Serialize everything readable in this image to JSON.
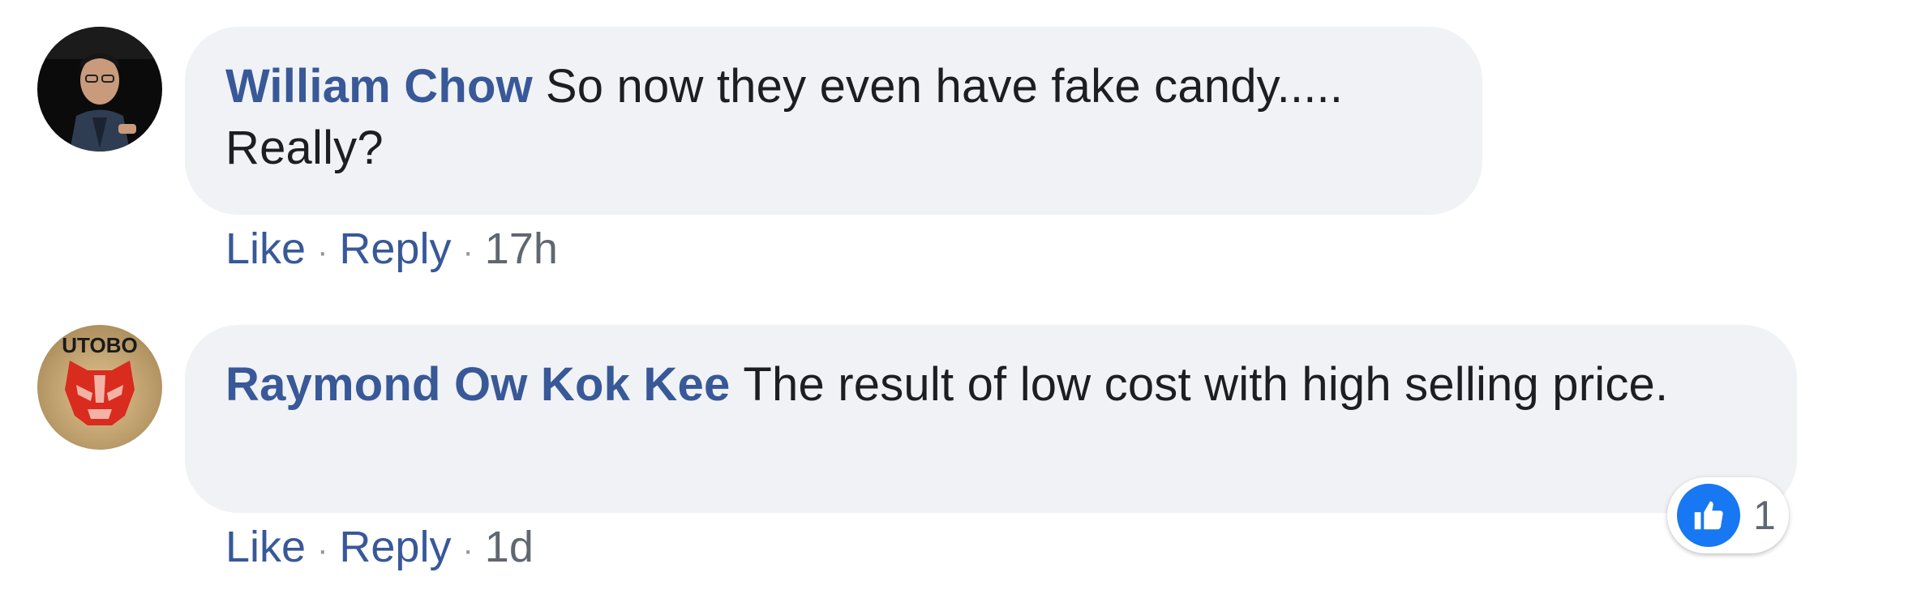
{
  "comments": [
    {
      "author": "William Chow",
      "text": "So now they even have fake candy..... Really?",
      "actions": {
        "like": "Like",
        "reply": "Reply",
        "separator": "·",
        "time": "17h"
      }
    },
    {
      "author": "Raymond Ow Kok Kee",
      "text": "The result of low cost with high selling price.",
      "actions": {
        "like": "Like",
        "reply": "Reply",
        "separator": "·",
        "time": "1d"
      },
      "reactions": {
        "icon": "thumbs-up-icon",
        "count": "1"
      },
      "avatar_text": "UTOBO"
    }
  ],
  "colors": {
    "author": "#385898",
    "bubble": "#f0f2f5",
    "text": "#1c1e21",
    "like_badge": "#1877f2",
    "meta": "#606770"
  }
}
